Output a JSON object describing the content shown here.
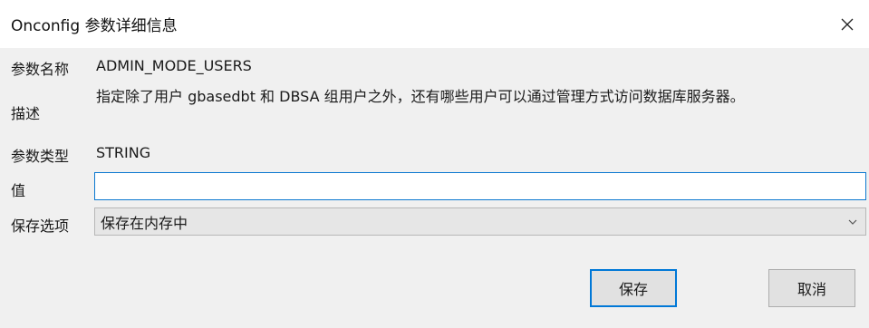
{
  "window": {
    "title": "Onconfig 参数详细信息",
    "close_glyph": "✕"
  },
  "fields": {
    "name_label": "参数名称",
    "name_value": "ADMIN_MODE_USERS",
    "desc_label": "描述",
    "desc_value": "指定除了用户 gbasedbt 和 DBSA 组用户之外，还有哪些用户可以通过管理方式访问数据库服务器。",
    "type_label": "参数类型",
    "type_value": "STRING",
    "value_label": "值",
    "value_input": "",
    "save_option_label": "保存选项",
    "save_option_selected": "保存在内存中"
  },
  "buttons": {
    "save": "保存",
    "cancel": "取消"
  },
  "colors": {
    "accent": "#0078d7",
    "background": "#f0f0f0"
  }
}
